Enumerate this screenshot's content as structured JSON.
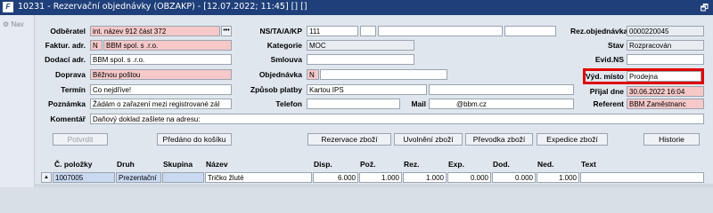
{
  "window": {
    "app_icon": "F",
    "title": "10231 - Rezervační objednávky (OBZAKP) - [12.07.2022; 11:45] [] []",
    "restore_glyph": "🗗"
  },
  "sidebar": {
    "nav_label": "Nav",
    "nav_icon": "gear-icon"
  },
  "form": {
    "odberatel": {
      "label": "Odběratel",
      "value": "int. název 912 část 372",
      "ellipsis": "•••"
    },
    "faktur_adr": {
      "label": "Faktur. adr.",
      "code": "N",
      "value": "BBM spol. s .r.o."
    },
    "dodaci_adr": {
      "label": "Dodací adr.",
      "value": "BBM spol. s .r.o."
    },
    "doprava": {
      "label": "Doprava",
      "value": "Běžnou poštou"
    },
    "termin": {
      "label": "Termín",
      "value": "Co nejdříve!"
    },
    "poznamka": {
      "label": "Poznámka",
      "value": "Žádám o zařazení mezi registrované zál"
    },
    "komentar": {
      "label": "Komentář",
      "value": "Daňový doklad zašlete na adresu:"
    },
    "ns_ta": {
      "label": "NS/TA/A/KP",
      "value": "111"
    },
    "kategorie": {
      "label": "Kategorie",
      "value": "MOC"
    },
    "smlouva": {
      "label": "Smlouva",
      "value": ""
    },
    "objednavka": {
      "label": "Objednávka",
      "code": "N",
      "value": ""
    },
    "zpusob_platby": {
      "label": "Způsob platby",
      "value": "Kartou IPS"
    },
    "telefon": {
      "label": "Telefon",
      "value": ""
    },
    "mail": {
      "label": "Mail",
      "value": "@bbm.cz"
    },
    "rez_objednavka": {
      "label": "Rez.objednávka",
      "value": "0000220045"
    },
    "stav": {
      "label": "Stav",
      "value": "Rozpracován"
    },
    "evid_ns": {
      "label": "Evid.NS",
      "value": ""
    },
    "vyd_misto": {
      "label": "Výd. místo",
      "value": "Prodejna"
    },
    "prijal_dne": {
      "label": "Přijal dne",
      "value": "30.06.2022 16:04"
    },
    "referent": {
      "label": "Referent",
      "value": "BBM Zaměstnanc"
    }
  },
  "buttons": {
    "potvrdit": "Potvrdit",
    "predano": "Předáno do košíku",
    "rezervace": "Rezervace zboží",
    "uvolneni": "Uvolnění zboží",
    "prevodka": "Převodka zboží",
    "expedice": "Expedice zboží",
    "historie": "Historie"
  },
  "grid": {
    "columns": [
      "Č. položky",
      "Druh",
      "Skupina",
      "Název",
      "Disp.",
      "Pož.",
      "Rez.",
      "Exp.",
      "Dod.",
      "Ned.",
      "Text"
    ],
    "rows": [
      {
        "cislo": "1007005",
        "druh": "Prezentační",
        "skupina": "",
        "nazev": "Tričko žluté",
        "disp": "6.000",
        "poz": "1.000",
        "rez": "1.000",
        "exp": "0.000",
        "dod": "0.000",
        "ned": "1.000",
        "text": ""
      }
    ]
  },
  "colors": {
    "titlebar": "#1f3f7a",
    "required_field": "#f6c8c8",
    "highlight": "#e00000",
    "selected_cell": "#c9d9f0"
  }
}
